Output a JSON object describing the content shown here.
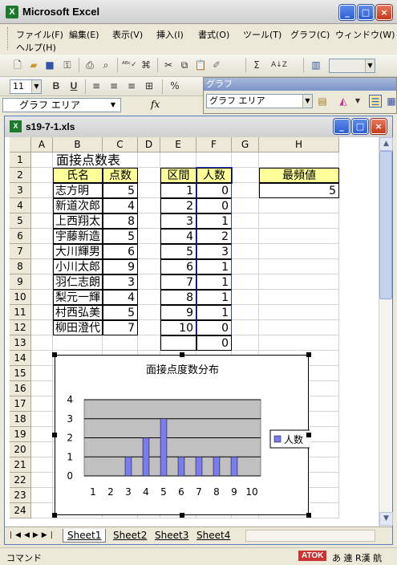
{
  "app": {
    "title": "Microsoft Excel",
    "icon": "excel-icon"
  },
  "menu": {
    "items": [
      "ファイル(F)",
      "編集(E)",
      "表示(V)",
      "挿入(I)",
      "書式(O)",
      "ツール(T)",
      "グラフ(C)",
      "ウィンドウ(W)",
      "ヘルプ(H)"
    ]
  },
  "format_toolbar": {
    "font_size": "11",
    "bold": "B",
    "underline": "U",
    "percent": "%"
  },
  "graph_toolbar": {
    "title": "グラフ",
    "object_select": "グラフ エリア"
  },
  "formula_bar": {
    "name_box": "グラフ エリア",
    "fx": "fx"
  },
  "workbook": {
    "title": "s19-7-1.xls",
    "columns": [
      "A",
      "B",
      "C",
      "D",
      "E",
      "F",
      "G",
      "H"
    ],
    "rows": [
      "1",
      "2",
      "3",
      "4",
      "5",
      "6",
      "7",
      "8",
      "9",
      "10",
      "11",
      "12",
      "13",
      "14",
      "15",
      "16",
      "17",
      "18",
      "19",
      "20",
      "21",
      "22",
      "23",
      "24"
    ]
  },
  "sheet": {
    "table_title": "面接点数表",
    "name_header": "氏名",
    "score_header": "点数",
    "people": [
      {
        "name": "志方明",
        "score": "5"
      },
      {
        "name": "新道次郎",
        "score": "4"
      },
      {
        "name": "上西翔太",
        "score": "8"
      },
      {
        "name": "宇藤新造",
        "score": "5"
      },
      {
        "name": "大川輝男",
        "score": "6"
      },
      {
        "name": "小川太郎",
        "score": "9"
      },
      {
        "name": "羽仁志朗",
        "score": "3"
      },
      {
        "name": "梨元一輝",
        "score": "4"
      },
      {
        "name": "村西弘美",
        "score": "5"
      },
      {
        "name": "柳田澄代",
        "score": "7"
      }
    ],
    "freq_header_bin": "区間",
    "freq_header_count": "人数",
    "freq": [
      {
        "bin": "1",
        "count": "0"
      },
      {
        "bin": "2",
        "count": "0"
      },
      {
        "bin": "3",
        "count": "1"
      },
      {
        "bin": "4",
        "count": "2"
      },
      {
        "bin": "5",
        "count": "3"
      },
      {
        "bin": "6",
        "count": "1"
      },
      {
        "bin": "7",
        "count": "1"
      },
      {
        "bin": "8",
        "count": "1"
      },
      {
        "bin": "9",
        "count": "1"
      },
      {
        "bin": "10",
        "count": "0"
      }
    ],
    "freq_extra": "0",
    "mode_header": "最頻値",
    "mode_value": "5",
    "header_fill": "#ffff99"
  },
  "chart_data": {
    "type": "bar",
    "title": "面接点度数分布",
    "categories": [
      "1",
      "2",
      "3",
      "4",
      "5",
      "6",
      "7",
      "8",
      "9",
      "10"
    ],
    "series": [
      {
        "name": "人数",
        "values": [
          0,
          0,
          1,
          2,
          3,
          1,
          1,
          1,
          1,
          0
        ],
        "color": "#7b7bf0"
      }
    ],
    "ylim": [
      0,
      4
    ],
    "yticks": [
      "0",
      "1",
      "2",
      "3",
      "4"
    ],
    "xlabel": "",
    "ylabel": "",
    "grid": true,
    "plot_background": "#c0c0c0",
    "legend": "right"
  },
  "tabs": [
    "Sheet1",
    "Sheet2",
    "Sheet3",
    "Sheet4"
  ],
  "status": {
    "text": "コマンド",
    "ime": "ATOK",
    "ime_modes": "あ 連 R漢 航"
  }
}
